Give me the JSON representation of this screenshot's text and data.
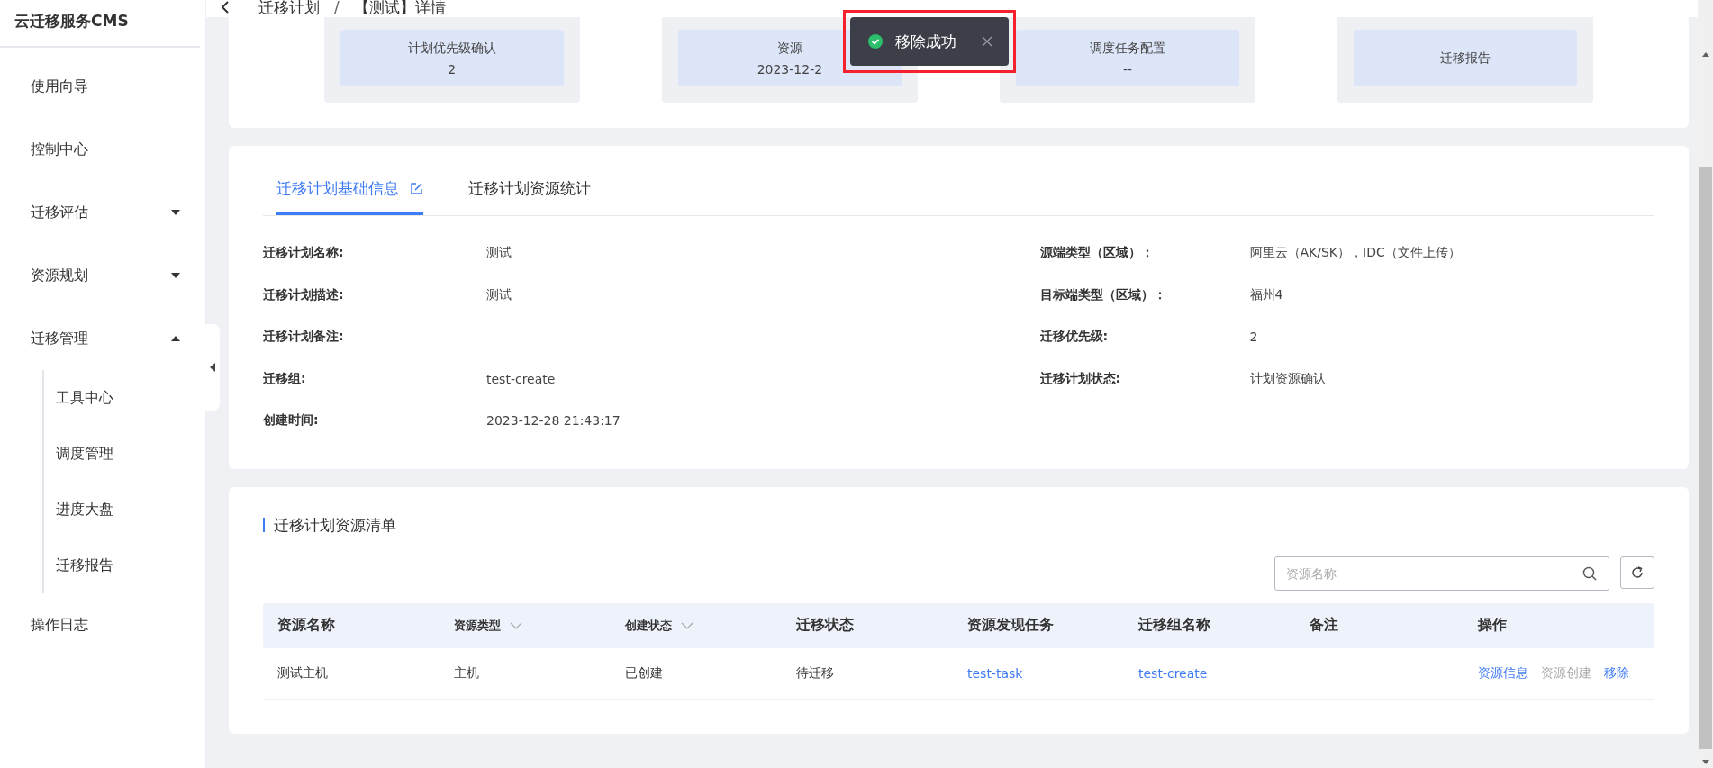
{
  "sidebar": {
    "title": "云迁移服务CMS",
    "items": [
      {
        "label": "使用向导"
      },
      {
        "label": "控制中心"
      },
      {
        "label": "迁移评估",
        "expanded": false
      },
      {
        "label": "资源规划",
        "expanded": false
      },
      {
        "label": "迁移管理",
        "expanded": true,
        "children": [
          {
            "label": "工具中心"
          },
          {
            "label": "调度管理"
          },
          {
            "label": "进度大盘"
          },
          {
            "label": "迁移报告"
          }
        ]
      },
      {
        "label": "操作日志"
      }
    ]
  },
  "breadcrumb": [
    "迁移计划",
    "/",
    "【测试】详情"
  ],
  "steps": [
    {
      "label": "计划优先级确认",
      "value": "2"
    },
    {
      "label": "资源",
      "value": "2023-12-2"
    },
    {
      "label": "调度任务配置",
      "value": "--"
    },
    {
      "label": "迁移报告"
    }
  ],
  "toast": {
    "text": "移除成功",
    "kind": "success"
  },
  "tabs": [
    {
      "label": "迁移计划基础信息",
      "selected": true,
      "editable": true
    },
    {
      "label": "迁移计划资源统计",
      "selected": false,
      "editable": false
    }
  ],
  "details_left": [
    {
      "label": "迁移计划名称:",
      "value": "测试"
    },
    {
      "label": "迁移计划描述:",
      "value": "测试"
    },
    {
      "label": "迁移计划备注:"
    },
    {
      "label": "迁移组:",
      "value": "test-create"
    },
    {
      "label": "创建时间:",
      "value": "2023-12-28 21:43:17"
    }
  ],
  "details_right": [
    {
      "label": "源端类型（区域）：",
      "value": "阿里云（AK/SK），IDC（文件上传）"
    },
    {
      "label": "目标端类型（区域）：",
      "value": "福州4"
    },
    {
      "label": "迁移优先级:",
      "value": "2"
    },
    {
      "label": "迁移计划状态:",
      "value": "计划资源确认"
    }
  ],
  "resources": {
    "title": "迁移计划资源清单",
    "search": {
      "placeholder": "资源名称"
    },
    "columns": [
      {
        "label": "资源名称",
        "kind": "plain"
      },
      {
        "label": "资源类型",
        "kind": "filter"
      },
      {
        "label": "创建状态",
        "kind": "filter"
      },
      {
        "label": "迁移状态",
        "kind": "plain"
      },
      {
        "label": "资源发现任务",
        "kind": "plain"
      },
      {
        "label": "迁移组名称",
        "kind": "plain"
      },
      {
        "label": "备注",
        "kind": "plain"
      },
      {
        "label": "操作",
        "kind": "plain"
      }
    ],
    "rows": [
      {
        "cells": [
          {
            "text": "测试主机",
            "kind": "text"
          },
          {
            "text": "主机",
            "kind": "text"
          },
          {
            "text": "已创建",
            "kind": "text"
          },
          {
            "text": "待迁移",
            "kind": "text"
          },
          {
            "text": "test-task",
            "kind": "link"
          },
          {
            "text": "test-create",
            "kind": "link"
          }
        ],
        "actions": [
          {
            "label": "资源信息",
            "disabled": false
          },
          {
            "label": "资源创建",
            "disabled": true
          },
          {
            "label": "移除",
            "disabled": false
          }
        ]
      }
    ]
  }
}
